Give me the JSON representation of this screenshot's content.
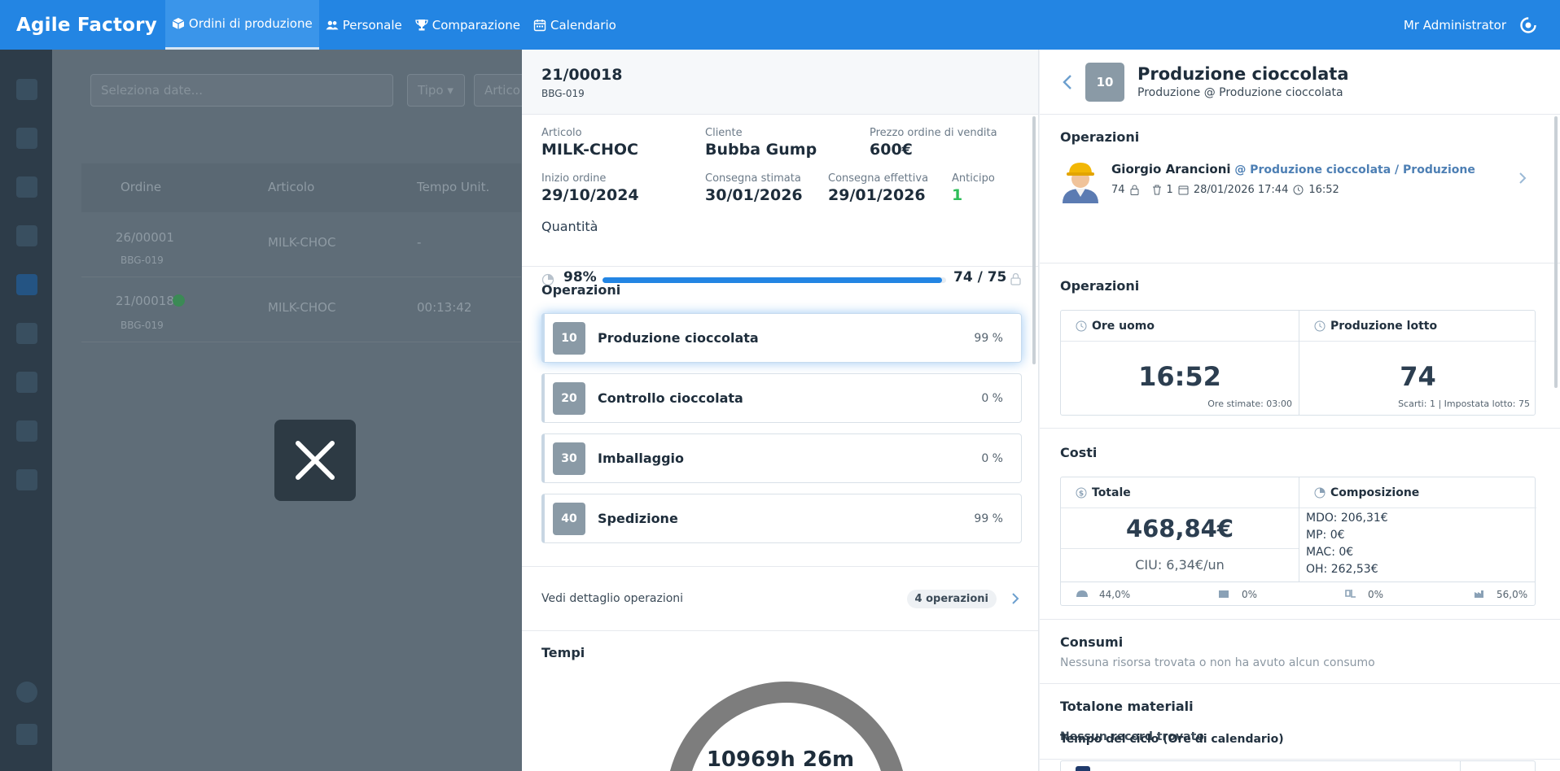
{
  "topbar": {
    "brand": "Agile Factory",
    "nav": [
      {
        "label": "Ordini di produzione",
        "icon": "box-icon"
      },
      {
        "label": "Personale",
        "icon": "users-icon"
      },
      {
        "label": "Comparazione",
        "icon": "trophy-icon"
      },
      {
        "label": "Calendario",
        "icon": "calendar-icon"
      }
    ],
    "user": "Mr Administrator"
  },
  "background": {
    "date_placeholder": "Seleziona date...",
    "type_filter": "Tipo",
    "article_filter": "Artico",
    "columns": [
      "Ordine",
      "Articolo",
      "Tempo Unit."
    ],
    "rows": [
      {
        "order": "26/00001",
        "code": "BBG-019",
        "article": "MILK-CHOC",
        "time": "-"
      },
      {
        "order": "21/00018",
        "code": "BBG-019",
        "article": "MILK-CHOC",
        "time": "00:13:42"
      }
    ]
  },
  "order": {
    "number": "21/00018",
    "code": "BBG-019",
    "labels": {
      "article": "Articolo",
      "customer": "Cliente",
      "price": "Prezzo ordine di vendita",
      "start": "Inizio ordine",
      "estimated": "Consegna stimata",
      "actual": "Consegna effettiva",
      "advance": "Anticipo",
      "quantity": "Quantità"
    },
    "article": "MILK-CHOC",
    "customer": "Bubba Gump",
    "price": "600€",
    "start": "29/10/2024",
    "estimated": "30/01/2026",
    "actual": "29/01/2026",
    "advance": "1",
    "quantity_pct": "98%",
    "quantity_fraction": 0.987,
    "quantity_count": "74 / 75",
    "operations_title": "Operazioni",
    "operations": [
      {
        "num": "10",
        "name": "Produzione cioccolata",
        "pct": "99 %"
      },
      {
        "num": "20",
        "name": "Controllo cioccolata",
        "pct": "0 %"
      },
      {
        "num": "30",
        "name": "Imballaggio",
        "pct": "0 %"
      },
      {
        "num": "40",
        "name": "Spedizione",
        "pct": "99 %"
      }
    ],
    "detail_link": "Vedi dettaglio operazioni",
    "detail_count": "4 operazioni",
    "times_title": "Tempi",
    "times_value": "10969h 26m"
  },
  "operation": {
    "num": "10",
    "title": "Produzione cioccolata",
    "subtitle": "Produzione @ Produzione cioccolata",
    "ops_title": "Operazioni",
    "worker": {
      "name": "Giorgio Arancioni",
      "location": "@ Produzione cioccolata / Produzione",
      "qty": "74",
      "scrap": "1",
      "datetime": "28/01/2026 17:44",
      "duration": "16:52"
    },
    "ops_title2": "Operazioni",
    "man_hours_label": "Ore uomo",
    "man_hours": "16:52",
    "estimated_hours": "Ore stimate: 03:00",
    "lot_label": "Produzione lotto",
    "lot": "74",
    "lot_info": "Scarti: 1 | Impostata lotto: 75",
    "costs_title": "Costi",
    "total_label": "Totale",
    "total": "468,84€",
    "ciu": "CIU: 6,34€/un",
    "composition_label": "Composizione",
    "composition": [
      {
        "k": "MDO",
        "v": "206,31€"
      },
      {
        "k": "MP",
        "v": "0€"
      },
      {
        "k": "MAC",
        "v": "0€"
      },
      {
        "k": "OH",
        "v": "262,53€"
      }
    ],
    "breakdown": [
      "44,0%",
      "0%",
      "0%",
      "56,0%"
    ],
    "consumption_title": "Consumi",
    "consumption_empty": "Nessuna risorsa trovata o non ha avuto alcun consumo",
    "materials_title": "Totalone materiali",
    "materials_empty": "Nessun record trovato",
    "cycle_title": "Tempo del ciclo (Ore di calendario)"
  },
  "colors": {
    "accent": "#2385e3",
    "success": "#2ebd59",
    "badge": "#8a9aa6"
  }
}
